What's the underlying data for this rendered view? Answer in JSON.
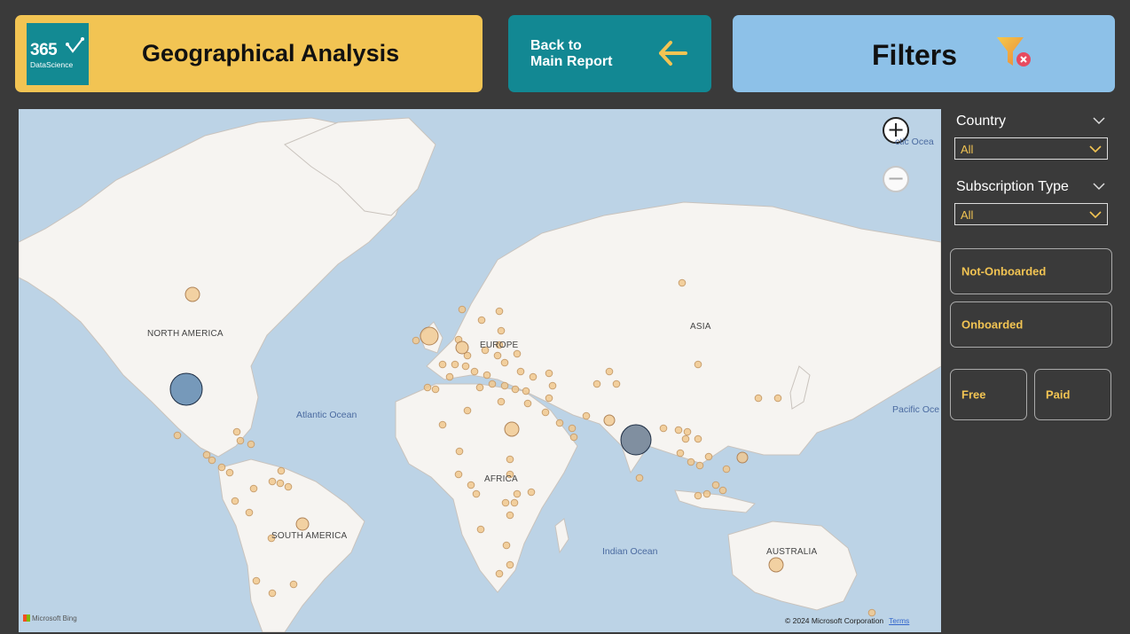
{
  "header": {
    "logo_number": "365",
    "logo_text": "DataScience",
    "title": "Geographical Analysis",
    "back_line1": "Back to",
    "back_line2": "Main Report",
    "filters_title": "Filters"
  },
  "icons": {
    "back": "arrow-left-icon",
    "clear_filters": "funnel-clear-icon",
    "zoom_in": "plus-icon",
    "zoom_out": "minus-icon"
  },
  "colors": {
    "title_bg": "#f2c453",
    "back_bg": "#128893",
    "filters_bg": "#8dc1e8",
    "accent": "#f2c453",
    "bubble_small": "#f1c88e",
    "bubble_large": "#5f88b0"
  },
  "map": {
    "labels": {
      "north_america": "NORTH AMERICA",
      "south_america": "SOUTH AMERICA",
      "europe": "EUROPE",
      "africa": "AFRICA",
      "asia": "ASIA",
      "australia": "AUSTRALIA"
    },
    "oceans": {
      "atlantic": "Atlantic Ocean",
      "indian": "Indian Ocean",
      "pacific": "Pacific Oce",
      "arctic": "ctic Ocea"
    },
    "attribution": "Microsoft Bing",
    "copyright": "© 2024 Microsoft Corporation",
    "terms": "Terms"
  },
  "filters": {
    "country": {
      "label": "Country",
      "value": "All"
    },
    "subscription": {
      "label": "Subscription Type",
      "value": "All"
    },
    "buttons": {
      "not_onboarded": "Not-Onboarded",
      "onboarded": "Onboarded",
      "free": "Free",
      "paid": "Paid"
    }
  }
}
